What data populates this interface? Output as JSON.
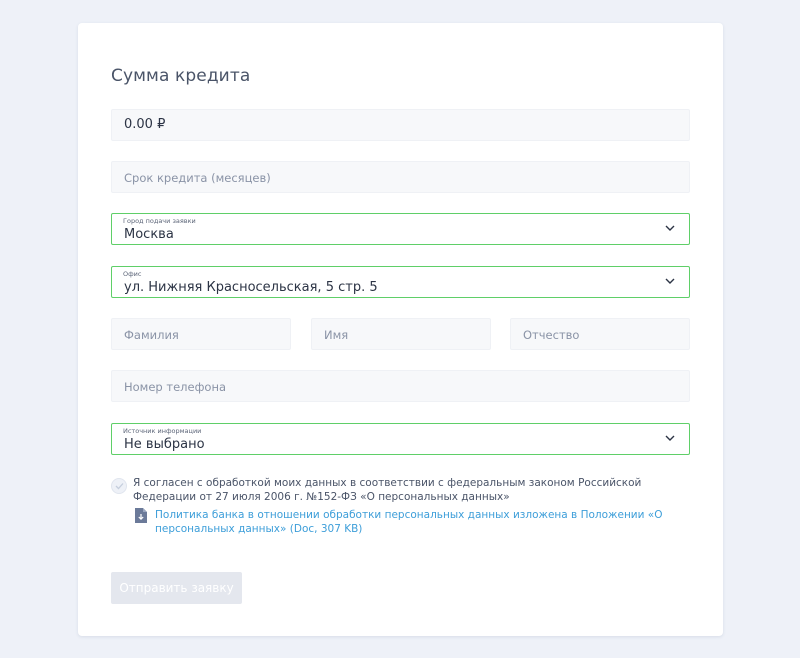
{
  "form": {
    "title": "Сумма кредита",
    "amount": {
      "value": "0.00 ₽"
    },
    "term": {
      "placeholder": "Срок кредита (месяцев)"
    },
    "city": {
      "label": "Город подачи заявки",
      "value": "Москва"
    },
    "office": {
      "label": "Офис",
      "value": "ул. Нижняя Красносельская, 5 стр. 5"
    },
    "surname": {
      "placeholder": "Фамилия"
    },
    "name": {
      "placeholder": "Имя"
    },
    "patronymic": {
      "placeholder": "Отчество"
    },
    "phone": {
      "placeholder": "Номер телефона"
    },
    "source": {
      "label": "Источник информации",
      "value": "Не выбрано"
    },
    "consent": {
      "checked": true,
      "text": "Я согласен с обработкой моих данных в соответствии с федеральным законом Российской Федерации от 27 июля 2006 г. №152-ФЗ «О персональных данных»"
    },
    "policy_link": "Политика банка в отношении обработки персональных данных изложена в Положении «О персональных данных» (Doc, 307 KB)",
    "submit_label": "Отправить заявку"
  },
  "colors": {
    "page_bg": "#eef1f8",
    "active_border": "#5fcf68",
    "link": "#3d9ed9",
    "button_disabled": "#e4e7ee"
  },
  "icons": {
    "chevron": "chevron-down-icon",
    "check": "check-icon",
    "document": "document-download-icon"
  }
}
